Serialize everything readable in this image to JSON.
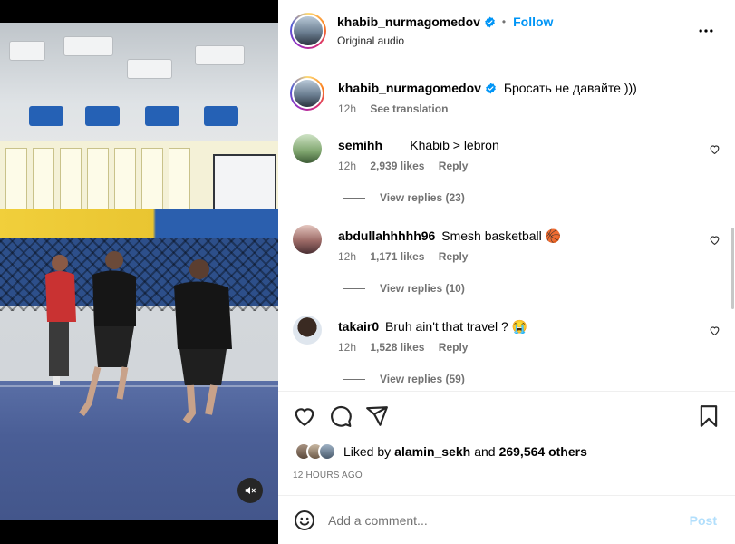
{
  "header": {
    "username": "khabib_nurmagomedov",
    "separator": "•",
    "follow_label": "Follow",
    "subtitle": "Original audio"
  },
  "caption": {
    "username": "khabib_nurmagomedov",
    "text": "Бросать не давайте )))",
    "time": "12h",
    "translation_label": "See translation"
  },
  "comments": [
    {
      "username": "semihh___",
      "text": "Khabib > lebron",
      "time": "12h",
      "likes": "2,939 likes",
      "reply_label": "Reply",
      "view_replies": "View replies (23)"
    },
    {
      "username": "abdullahhhhh96",
      "text": "Smesh basketball 🏀",
      "time": "12h",
      "likes": "1,171 likes",
      "reply_label": "Reply",
      "view_replies": "View replies (10)"
    },
    {
      "username": "takair0",
      "text": "Bruh ain't that travel ? 😭",
      "time": "12h",
      "likes": "1,528 likes",
      "reply_label": "Reply",
      "view_replies": "View replies (59)"
    }
  ],
  "likes": {
    "prefix": "Liked by",
    "user": "alamin_sekh",
    "conj": "and",
    "others": "269,564 others"
  },
  "post_time": "12 HOURS AGO",
  "add_comment": {
    "placeholder": "Add a comment...",
    "post_label": "Post"
  },
  "icons": {
    "verified": "verified-badge-icon",
    "more": "more-options-icon",
    "like": "heart-icon",
    "comment": "comment-icon",
    "share": "share-icon",
    "save": "bookmark-icon",
    "emoji": "emoji-icon",
    "mute": "muted-speaker-icon"
  },
  "colors": {
    "link": "#0095f6",
    "muted_text": "#737373",
    "verified": "#0095f6",
    "post_disabled": "#b2dffc"
  }
}
